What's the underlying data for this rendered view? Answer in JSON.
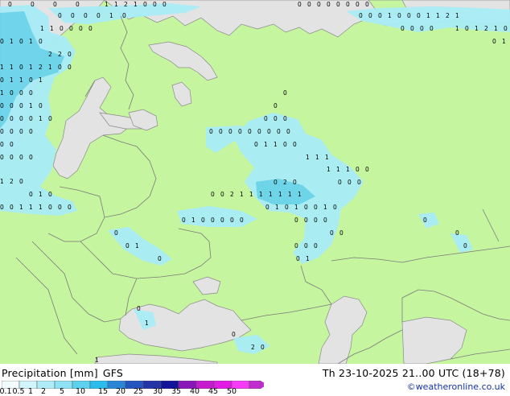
{
  "map": {
    "colors": {
      "land": "#c6f5a0",
      "sea": "#e3e3e3",
      "non_forecast_land": "#e3e3e3",
      "border": "#7a7a7a",
      "coast": "#8a8a8a",
      "precip_light": "#a8ecf6",
      "precip_mid": "#6ad4ec"
    }
  },
  "legend": {
    "title": "Precipitation [mm]",
    "model": "GFS",
    "labels": [
      "0.1",
      "0.5",
      "1",
      "2",
      "5",
      "10",
      "15",
      "20",
      "25",
      "30",
      "35",
      "40",
      "45",
      "50"
    ],
    "swatches": [
      "#f2fcfe",
      "#d2f4fc",
      "#b0ecf8",
      "#8ee2f4",
      "#5cd2ee",
      "#2cbcec",
      "#2b86d6",
      "#2555bf",
      "#2234a6",
      "#14149a",
      "#8a16b8",
      "#c41ccc",
      "#e21ce4",
      "#f63af6",
      "#c02ed0"
    ]
  },
  "datetime": "Th 23-10-2025 21..00 UTC (18+78)",
  "credit": "©weatheronline.co.uk"
}
